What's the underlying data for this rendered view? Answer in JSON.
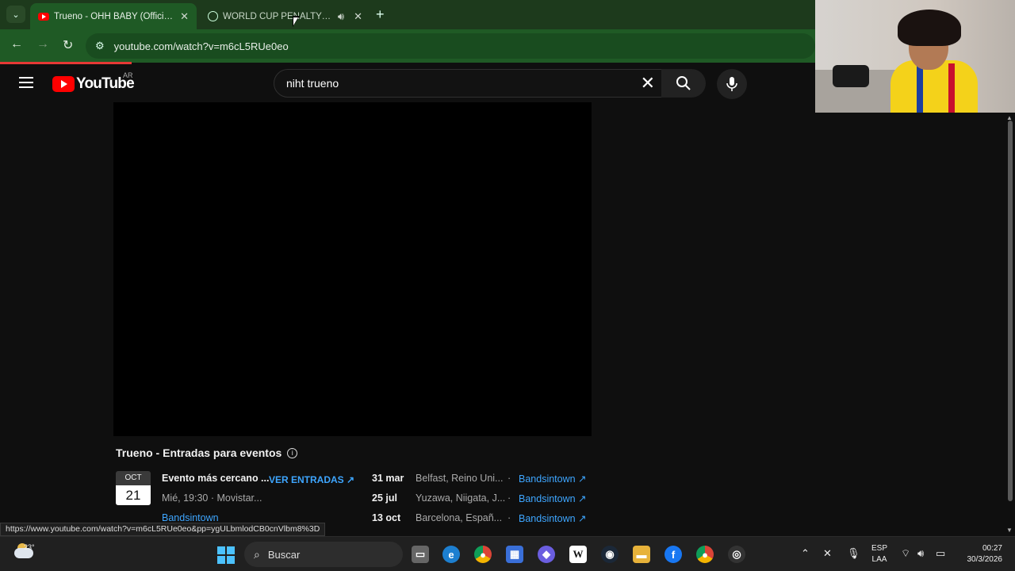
{
  "browser": {
    "tabs": [
      {
        "title": "Trueno - OHH BABY (Official Vi",
        "active": true
      },
      {
        "title": "WORLD CUP PENALTY jueg",
        "active": false
      }
    ],
    "url": "youtube.com/watch?v=m6cL5RUe0eo",
    "status_url": "https://www.youtube.com/watch?v=m6cL5RUe0eo&pp=ygULbmlodCB0cnVlbm8%3D"
  },
  "youtube": {
    "logo_text": "YouTube",
    "country_code": "AR",
    "search_query": "niht trueno"
  },
  "events": {
    "title": "Trueno - Entradas para eventos",
    "featured": {
      "month": "OCT",
      "day": "21",
      "name": "Evento más cercano ...",
      "details": "Mié, 19:30 · Movistar...",
      "provider": "Bandsintown",
      "cta": "VER ENTRADAS"
    },
    "list": [
      {
        "date": "31 mar",
        "location": "Belfast, Reino Uni...",
        "provider": "Bandsintown"
      },
      {
        "date": "25 jul",
        "location": "Yuzawa, Niigata, J...",
        "provider": "Bandsintown"
      },
      {
        "date": "13 oct",
        "location": "Barcelona, Españ...",
        "provider": "Bandsintown"
      }
    ]
  },
  "taskbar": {
    "temperature": "23°",
    "search_placeholder": "Buscar",
    "language": [
      "ESP",
      "LAA"
    ],
    "time": "00:27",
    "date": "30/3/2026"
  }
}
